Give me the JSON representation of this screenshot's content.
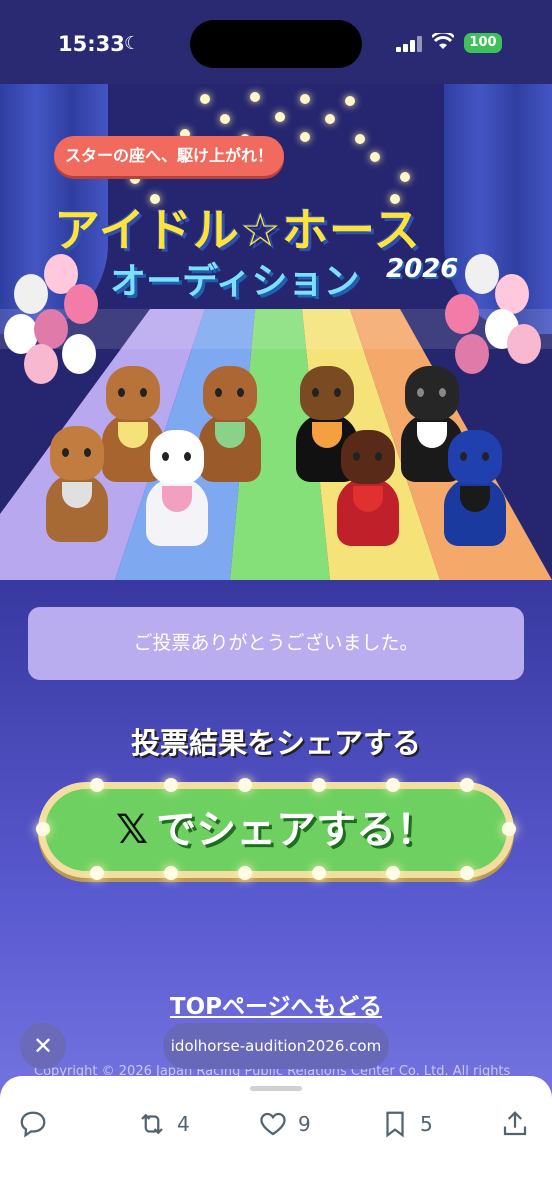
{
  "status_bar": {
    "time": "15:33",
    "battery": "100"
  },
  "hero": {
    "tagline": "スターの座へ、駆け上がれ！",
    "title_line1": "アイドル☆ホース",
    "title_line2": "オーディション",
    "year": "2026"
  },
  "message": "ご投票ありがとうございました。",
  "share": {
    "heading": "投票結果をシェアする",
    "button_icon": "𝕏",
    "button_label": "でシェアする！"
  },
  "top_link": "TOPページへもどる",
  "copyright": "Copyright © 2026 Japan Racing Public Relations Center Co. Ltd. All rights",
  "browser": {
    "url": "idolhorse-audition2026.com",
    "close_icon": "close-icon"
  },
  "actions": {
    "reply": "",
    "repost": "4",
    "like": "9",
    "bookmark": "5"
  },
  "colors": {
    "accent_green": "#6ed060",
    "message_bg": "#b9adf0",
    "tagline_bg": "#f06a5e"
  }
}
